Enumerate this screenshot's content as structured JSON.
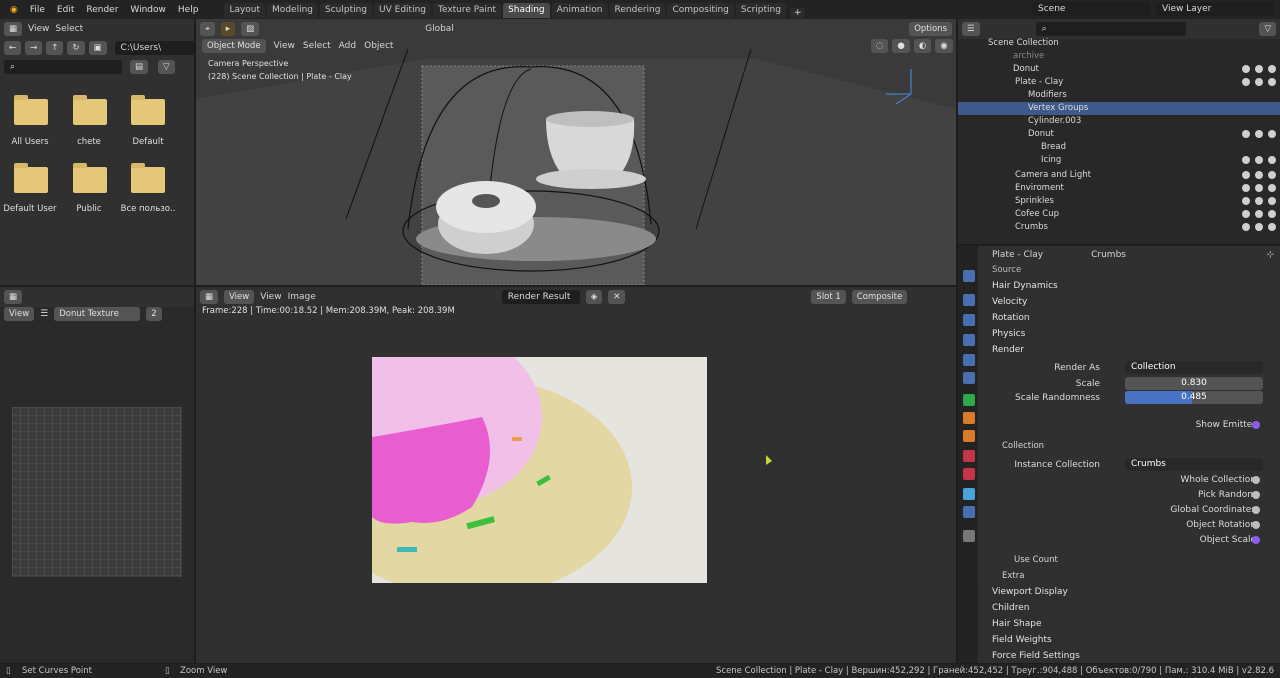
{
  "menu": [
    "File",
    "Edit",
    "Render",
    "Window",
    "Help"
  ],
  "tabs": [
    "Layout",
    "Modeling",
    "Sculpting",
    "UV Editing",
    "Texture Paint",
    "Shading",
    "Animation",
    "Rendering",
    "Compositing",
    "Scripting"
  ],
  "active_tab": "Shading",
  "top_right": {
    "scene": "Scene",
    "view_layer": "View Layer"
  },
  "file_browser": {
    "menu": [
      "View",
      "Select"
    ],
    "path": "C:\\Users\\",
    "items": [
      "All Users",
      "chete",
      "Default",
      "Default User",
      "Public",
      "Все пользо.."
    ]
  },
  "viewport": {
    "mode": "Object Mode",
    "menus": [
      "View",
      "Select",
      "Add",
      "Object"
    ],
    "orientation": "Global",
    "options": "Options",
    "camera_label": "Camera Perspective",
    "collection_label": "(228) Scene Collection | Plate - Clay"
  },
  "image_editor": {
    "menus": [
      "View",
      "View",
      "Image"
    ],
    "image_name": "Render Result",
    "slot": "Slot 1",
    "pass": "Composite",
    "info": "Frame:228 | Time:00:18.52 | Mem:208.39M, Peak: 208.39M"
  },
  "texture_panel": {
    "view": "View",
    "texture": "Donut Texture",
    "users": "2"
  },
  "outliner": {
    "title": "Scene Collection",
    "rows": [
      {
        "label": "archive"
      },
      {
        "label": "Donut"
      },
      {
        "label": "Plate - Clay"
      },
      {
        "label": "Modifiers"
      },
      {
        "label": "Vertex Groups"
      },
      {
        "label": "Cylinder.003"
      },
      {
        "label": "Donut"
      },
      {
        "label": "Bread"
      },
      {
        "label": "Icing"
      },
      {
        "label": "Camera and Light"
      },
      {
        "label": "Enviroment"
      },
      {
        "label": "Sprinkles"
      },
      {
        "label": "Cofee Cup"
      },
      {
        "label": "Crumbs"
      }
    ]
  },
  "properties": {
    "object": "Plate - Clay",
    "particle": "Crumbs",
    "source": "Source",
    "hair_dynamics": "Hair Dynamics",
    "velocity": "Velocity",
    "rotation": "Rotation",
    "physics": "Physics",
    "render": "Render",
    "render_as_label": "Render As",
    "render_as": "Collection",
    "scale_label": "Scale",
    "scale": "0.830",
    "scale_rand_label": "Scale Randomness",
    "scale_rand": "0.485",
    "show_emitter": "Show Emitter",
    "collection": "Collection",
    "instance_collection_label": "Instance Collection",
    "instance_collection": "Crumbs",
    "whole_collection": "Whole Collection",
    "pick_random": "Pick Random",
    "global_coords": "Global Coordinates",
    "object_rotation": "Object Rotation",
    "object_scale": "Object Scale",
    "use_count": "Use Count",
    "extra": "Extra",
    "viewport_display": "Viewport Display",
    "children": "Children",
    "hair_shape": "Hair Shape",
    "field_weights": "Field Weights",
    "force_field": "Force Field Settings"
  },
  "status": {
    "left": "Set Curves Point",
    "middle": "Zoom View",
    "right": "Scene Collection | Plate - Clay | Вершин:452,292 | Граней:452,452 | Треуг.:904,488 | Объектов:0/790 | Пам.: 310.4 MiB | v2.82.6"
  }
}
